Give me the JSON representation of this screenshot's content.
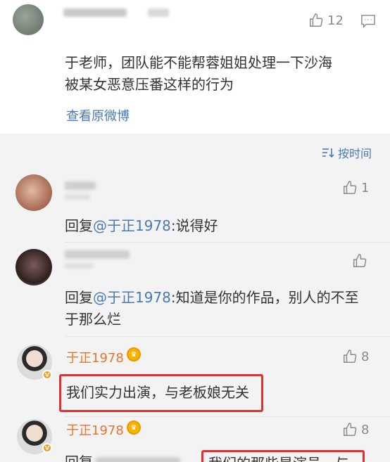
{
  "top_comment": {
    "like_count": "12",
    "text_line1": "于老师，团队能不能帮蓉姐姐处理一下沙海",
    "text_line2": "被某女恶意压番这样的行为",
    "view_original": "查看原微博"
  },
  "sort_label": "按时间",
  "replies": [
    {
      "like_count": "1",
      "prefix": "回复",
      "mention": "@于正1978",
      "text": ":说得好"
    },
    {
      "like_count": "",
      "prefix": "回复",
      "mention": "@于正1978",
      "text_line1": ":知道是你的作品，别人的不至",
      "text_line2": "于那么烂"
    },
    {
      "author": "于正1978",
      "like_count": "8",
      "text": "我们实力出演，与老板娘无关"
    },
    {
      "author": "于正1978",
      "like_count": "8",
      "prefix": "回复",
      "text": "我们的那些是演员，与"
    }
  ],
  "colors": {
    "mention": "#4a7ab5",
    "author": "#e8752b",
    "highlight_box": "#e23030"
  },
  "icons": {
    "like": "thumbs-up-icon",
    "comment": "comment-icon",
    "sort": "sort-icon",
    "crown": "crown-badge-icon",
    "verified": "verified-v-icon"
  }
}
